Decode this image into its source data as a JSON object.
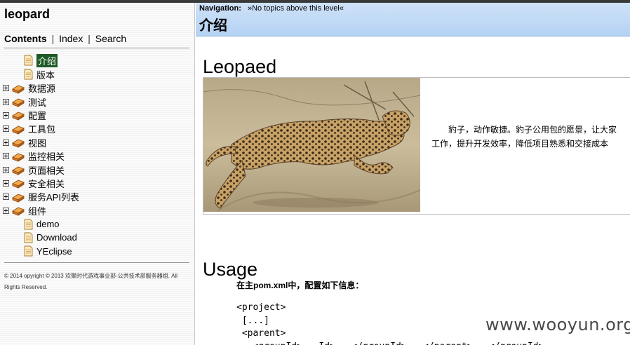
{
  "sidebar": {
    "brand": "leopard",
    "tabs": [
      {
        "label": "Contents",
        "active": true
      },
      {
        "label": "Index",
        "active": false
      },
      {
        "label": "Search",
        "active": false
      }
    ],
    "tab_separator": "|",
    "toc": [
      {
        "label": "介绍",
        "icon": "page-icon",
        "expandable": false,
        "selected": true
      },
      {
        "label": "版本",
        "icon": "page-icon",
        "expandable": false,
        "selected": false
      },
      {
        "label": "数据源",
        "icon": "book-icon",
        "expandable": true,
        "selected": false
      },
      {
        "label": "测试",
        "icon": "book-icon",
        "expandable": true,
        "selected": false
      },
      {
        "label": "配置",
        "icon": "book-icon",
        "expandable": true,
        "selected": false
      },
      {
        "label": "工具包",
        "icon": "book-icon",
        "expandable": true,
        "selected": false
      },
      {
        "label": "视图",
        "icon": "book-icon",
        "expandable": true,
        "selected": false
      },
      {
        "label": "监控相关",
        "icon": "book-icon",
        "expandable": true,
        "selected": false
      },
      {
        "label": "页面相关",
        "icon": "book-icon",
        "expandable": true,
        "selected": false
      },
      {
        "label": "安全相关",
        "icon": "book-icon",
        "expandable": true,
        "selected": false
      },
      {
        "label": "服务API列表",
        "icon": "book-icon",
        "expandable": true,
        "selected": false
      },
      {
        "label": "组件",
        "icon": "book-icon",
        "expandable": true,
        "selected": false
      },
      {
        "label": "demo",
        "icon": "page-icon",
        "expandable": false,
        "selected": false
      },
      {
        "label": "Download",
        "icon": "page-icon",
        "expandable": false,
        "selected": false
      },
      {
        "label": "YEclipse",
        "icon": "page-icon",
        "expandable": false,
        "selected": false
      }
    ],
    "copyright_line1": "© 2014 opyright © 2013 欢聚时代游戏事业部-公共技术部服务器组. All",
    "copyright_line2": "Rights Reserved."
  },
  "navigation": {
    "label": "Navigation:",
    "text": "»No topics above this level«"
  },
  "page": {
    "heading": "介绍",
    "section1_title": "Leopaed",
    "description_line1": "豹子，动作敏捷。豹子公用包的愿景，让大家",
    "description_line2": "工作，提升开发效率，降低项目熟悉和交接成本",
    "section2_title": "Usage",
    "usage_instruction": "在主pom.xml中，配置如下信息：",
    "code_lines": [
      "<project>",
      " [...]",
      " <parent>",
      "   <groupId>...Id>...</groupId>...</parent>...</groupId>"
    ]
  },
  "watermark": "www.wooyun.org",
  "colors": {
    "selected_bg": "#1e5a25",
    "nav_band": "#b4d2f3",
    "book_orange": "#e8913a"
  }
}
